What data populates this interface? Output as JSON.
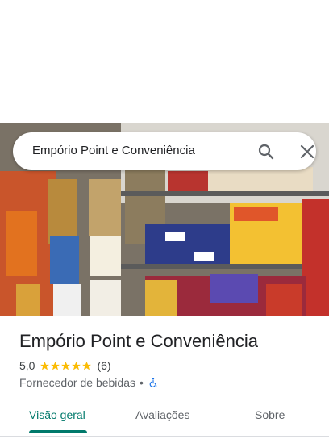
{
  "search": {
    "query": "Empório Point e Conveniência"
  },
  "place": {
    "name": "Empório Point e Conveniência",
    "rating": "5,0",
    "stars": 5,
    "review_count": "(6)",
    "category": "Fornecedor de bebidas",
    "separator": "•"
  },
  "tabs": [
    {
      "label": "Visão geral",
      "active": true
    },
    {
      "label": "Avaliações",
      "active": false
    },
    {
      "label": "Sobre",
      "active": false
    }
  ],
  "colors": {
    "accent": "#00796b",
    "star": "#fbbc04",
    "accessibility": "#1a73e8"
  },
  "icons": {
    "search": "search-icon",
    "close": "close-icon",
    "star": "star-icon",
    "accessibility": "wheelchair-icon"
  }
}
